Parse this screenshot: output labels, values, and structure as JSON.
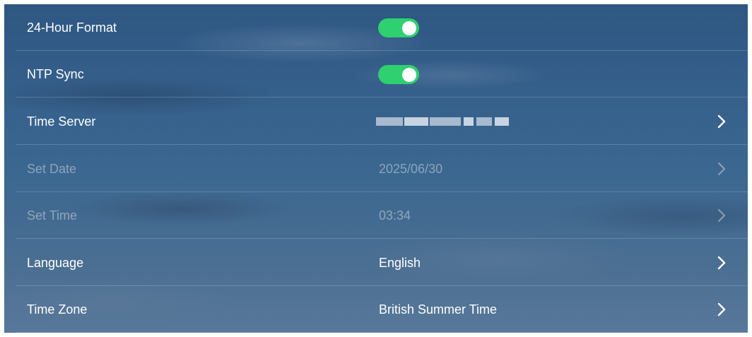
{
  "settings": {
    "rows": [
      {
        "label": "24-Hour Format",
        "control": "toggle",
        "toggle_on": true
      },
      {
        "label": "NTP Sync",
        "control": "toggle",
        "toggle_on": true
      },
      {
        "label": "Time Server",
        "control": "value",
        "value": "",
        "value_redacted": true
      },
      {
        "label": "Set Date",
        "control": "value",
        "value": "2025/06/30",
        "disabled": true
      },
      {
        "label": "Set Time",
        "control": "value",
        "value": "03:34",
        "disabled": true
      },
      {
        "label": "Language",
        "control": "value",
        "value": "English"
      },
      {
        "label": "Time Zone",
        "control": "value",
        "value": "British Summer Time"
      }
    ]
  },
  "colors": {
    "toggle_on": "#2ed06f",
    "background": "#36618c",
    "text": "#ffffff",
    "disabled_text": "rgba(255,255,255,0.40)"
  },
  "icons": {
    "chevron": "chevron-right-icon"
  }
}
